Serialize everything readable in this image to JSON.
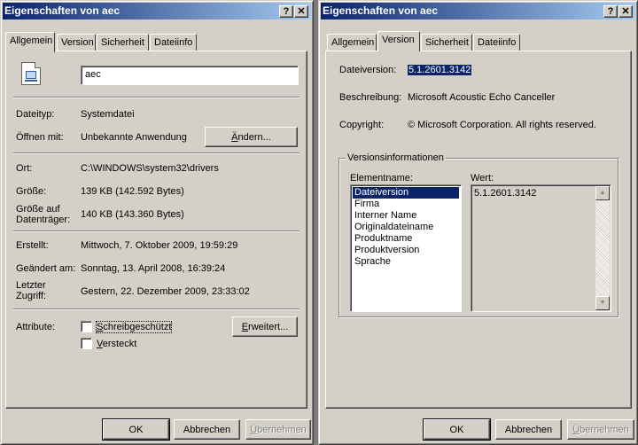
{
  "win1": {
    "title": "Eigenschaften von aec",
    "help_label": "?",
    "close_label": "✕",
    "tabs": [
      "Allgemein",
      "Version",
      "Sicherheit",
      "Dateiinfo"
    ],
    "general": {
      "icon": "system-file-icon",
      "filename": "aec",
      "rows": [
        {
          "label": "Dateityp:",
          "value": "Systemdatei"
        },
        {
          "label": "Öffnen mit:",
          "value": "Unbekannte Anwendung"
        },
        {
          "label": "Ort:",
          "value": "C:\\WINDOWS\\system32\\drivers"
        },
        {
          "label": "Größe:",
          "value": "139 KB (142.592 Bytes)"
        },
        {
          "label": "Größe auf Datenträger:",
          "value": "140 KB (143.360 Bytes)"
        },
        {
          "label": "Erstellt:",
          "value": "Mittwoch, 7. Oktober 2009, 19:59:29"
        },
        {
          "label": "Geändert am:",
          "value": "Sonntag, 13. April 2008, 16:39:24"
        },
        {
          "label": "Letzter Zugriff:",
          "value": "Gestern, 22. Dezember 2009, 23:33:02"
        }
      ],
      "change_button": {
        "pre": "",
        "ul": "Ä",
        "post": "ndern..."
      },
      "attributes_label": "Attribute:",
      "readonly": {
        "pre": "",
        "ul": "S",
        "post": "chreibgeschützt"
      },
      "hidden": {
        "pre": "",
        "ul": "V",
        "post": "ersteckt"
      },
      "advanced_button": {
        "pre": "",
        "ul": "E",
        "post": "rweitert..."
      }
    },
    "buttons": {
      "ok": "OK",
      "cancel": "Abbrechen",
      "apply": {
        "pre": "",
        "ul": "Ü",
        "post": "bernehmen"
      }
    }
  },
  "win2": {
    "title": "Eigenschaften von aec",
    "help_label": "?",
    "close_label": "✕",
    "tabs": [
      "Allgemein",
      "Version",
      "Sicherheit",
      "Dateiinfo"
    ],
    "version": {
      "file_version_label": "Dateiversion:",
      "file_version_value": "5.1.2601.3142",
      "description_label": "Beschreibung:",
      "description_value": "Microsoft Acoustic Echo Canceller",
      "copyright_label": "Copyright:",
      "copyright_value": "© Microsoft Corporation. All rights reserved.",
      "group_label": "Versionsinformationen",
      "element_label": "Elementname:",
      "value_label": "Wert:",
      "items": [
        "Dateiversion",
        "Firma",
        "Interner Name",
        "Originaldateiname",
        "Produktname",
        "Produktversion",
        "Sprache"
      ],
      "selected_value": "5.1.2601.3142",
      "scroll_up_glyph": "▲",
      "scroll_down_glyph": "▼"
    },
    "buttons": {
      "ok": "OK",
      "cancel": "Abbrechen",
      "apply": {
        "pre": "",
        "ul": "Ü",
        "post": "bernehmen"
      }
    }
  }
}
